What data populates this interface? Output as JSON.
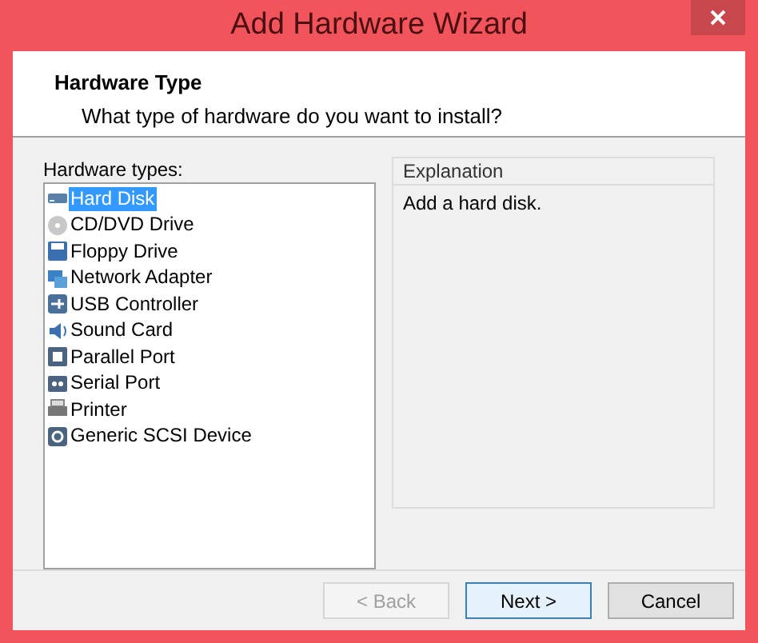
{
  "window": {
    "title": "Add Hardware Wizard"
  },
  "header": {
    "title": "Hardware Type",
    "subtitle": "What type of hardware do you want to install?"
  },
  "hardware_list": {
    "label": "Hardware types:",
    "items": [
      {
        "label": "Hard Disk",
        "selected": true
      },
      {
        "label": "CD/DVD Drive",
        "selected": false
      },
      {
        "label": "Floppy Drive",
        "selected": false
      },
      {
        "label": "Network Adapter",
        "selected": false
      },
      {
        "label": "USB Controller",
        "selected": false
      },
      {
        "label": "Sound Card",
        "selected": false
      },
      {
        "label": "Parallel Port",
        "selected": false
      },
      {
        "label": "Serial Port",
        "selected": false
      },
      {
        "label": "Printer",
        "selected": false
      },
      {
        "label": "Generic SCSI Device",
        "selected": false
      }
    ]
  },
  "explanation": {
    "title": "Explanation",
    "text": "Add a hard disk."
  },
  "buttons": [
    {
      "label": "< Back",
      "disabled": true
    },
    {
      "label": "Next >",
      "disabled": false,
      "default": true
    },
    {
      "label": "Cancel",
      "disabled": false
    }
  ]
}
